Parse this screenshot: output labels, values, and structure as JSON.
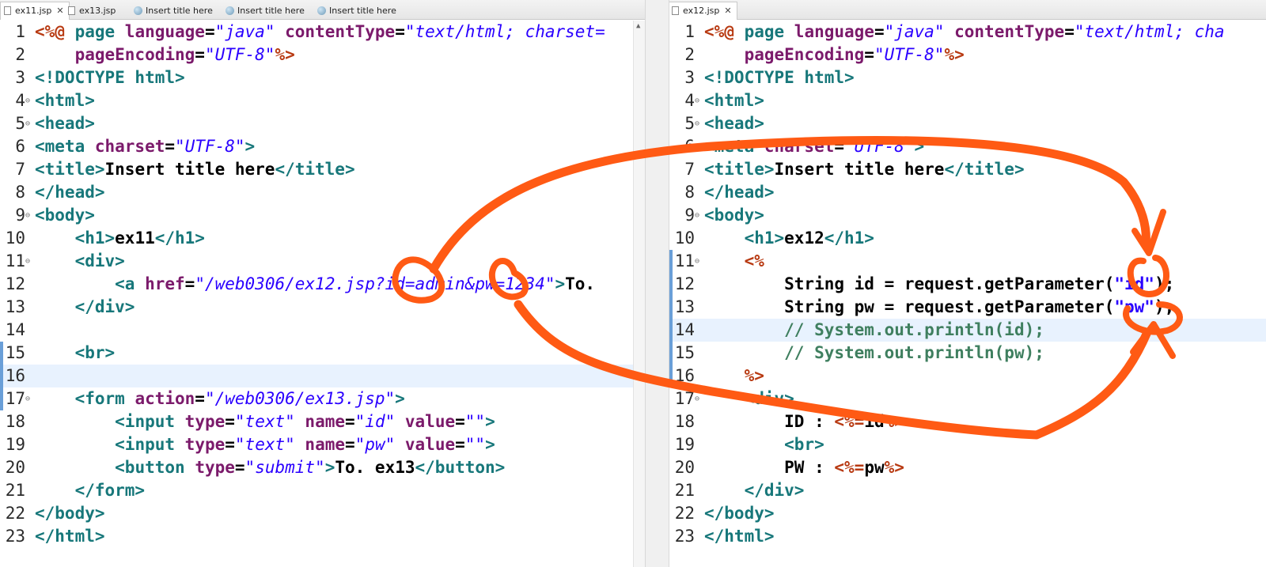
{
  "left_editor": {
    "tabs": [
      {
        "label": "ex11.jsp",
        "icon": "jsp-file-icon",
        "active": true,
        "closable": true
      },
      {
        "label": "ex13.jsp",
        "icon": "jsp-file-icon",
        "active": false,
        "closable": false
      },
      {
        "label": "Insert title here",
        "icon": "globe-icon",
        "active": false,
        "closable": false
      },
      {
        "label": "Insert title here",
        "icon": "globe-icon",
        "active": false,
        "closable": false
      },
      {
        "label": "Insert title here",
        "icon": "globe-icon",
        "active": false,
        "closable": false
      }
    ],
    "highlighted_line": 16,
    "folded_lines": [
      4,
      5,
      9,
      11,
      17
    ],
    "changed_lines": [
      15,
      16,
      17
    ],
    "lines": [
      [
        [
          "jsp",
          "<%@ "
        ],
        [
          "tag",
          "page "
        ],
        [
          "attr",
          "language"
        ],
        [
          "txt",
          "="
        ],
        [
          "val",
          "\"java\""
        ],
        [
          "txt",
          " "
        ],
        [
          "attr",
          "contentType"
        ],
        [
          "txt",
          "="
        ],
        [
          "val",
          "\"text/html; charset="
        ]
      ],
      [
        [
          "txt",
          "    "
        ],
        [
          "attr",
          "pageEncoding"
        ],
        [
          "txt",
          "="
        ],
        [
          "val",
          "\"UTF-8\""
        ],
        [
          "jsp",
          "%>"
        ]
      ],
      [
        [
          "tag",
          "<!DOCTYPE html>"
        ]
      ],
      [
        [
          "tag",
          "<html>"
        ]
      ],
      [
        [
          "tag",
          "<head>"
        ]
      ],
      [
        [
          "tag",
          "<meta "
        ],
        [
          "attr",
          "charset"
        ],
        [
          "txt",
          "="
        ],
        [
          "val",
          "\"UTF-8\""
        ],
        [
          "tag",
          ">"
        ]
      ],
      [
        [
          "tag",
          "<title>"
        ],
        [
          "txt",
          "Insert title here"
        ],
        [
          "tag",
          "</title>"
        ]
      ],
      [
        [
          "tag",
          "</head>"
        ]
      ],
      [
        [
          "tag",
          "<body>"
        ]
      ],
      [
        [
          "txt",
          "    "
        ],
        [
          "tag",
          "<h1>"
        ],
        [
          "txt",
          "ex11"
        ],
        [
          "tag",
          "</h1>"
        ]
      ],
      [
        [
          "txt",
          "    "
        ],
        [
          "tag",
          "<div>"
        ]
      ],
      [
        [
          "txt",
          "        "
        ],
        [
          "tag",
          "<a "
        ],
        [
          "attr",
          "href"
        ],
        [
          "txt",
          "="
        ],
        [
          "val",
          "\"/web0306/ex12.jsp?id=admin&pw=1234\""
        ],
        [
          "tag",
          ">"
        ],
        [
          "txt",
          "To."
        ]
      ],
      [
        [
          "txt",
          "    "
        ],
        [
          "tag",
          "</div>"
        ]
      ],
      [],
      [
        [
          "txt",
          "    "
        ],
        [
          "tag",
          "<br>"
        ]
      ],
      [],
      [
        [
          "txt",
          "    "
        ],
        [
          "tag",
          "<form "
        ],
        [
          "attr",
          "action"
        ],
        [
          "txt",
          "="
        ],
        [
          "val",
          "\"/web0306/ex13.jsp\""
        ],
        [
          "tag",
          ">"
        ]
      ],
      [
        [
          "txt",
          "        "
        ],
        [
          "tag",
          "<input "
        ],
        [
          "attr",
          "type"
        ],
        [
          "txt",
          "="
        ],
        [
          "val",
          "\"text\""
        ],
        [
          "txt",
          " "
        ],
        [
          "attr",
          "name"
        ],
        [
          "txt",
          "="
        ],
        [
          "val",
          "\"id\""
        ],
        [
          "txt",
          " "
        ],
        [
          "attr",
          "value"
        ],
        [
          "txt",
          "="
        ],
        [
          "val",
          "\"\""
        ],
        [
          "tag",
          ">"
        ]
      ],
      [
        [
          "txt",
          "        "
        ],
        [
          "tag",
          "<input "
        ],
        [
          "attr",
          "type"
        ],
        [
          "txt",
          "="
        ],
        [
          "val",
          "\"text\""
        ],
        [
          "txt",
          " "
        ],
        [
          "attr",
          "name"
        ],
        [
          "txt",
          "="
        ],
        [
          "val",
          "\"pw\""
        ],
        [
          "txt",
          " "
        ],
        [
          "attr",
          "value"
        ],
        [
          "txt",
          "="
        ],
        [
          "val",
          "\"\""
        ],
        [
          "tag",
          ">"
        ]
      ],
      [
        [
          "txt",
          "        "
        ],
        [
          "tag",
          "<button "
        ],
        [
          "attr",
          "type"
        ],
        [
          "txt",
          "="
        ],
        [
          "val",
          "\"submit\""
        ],
        [
          "tag",
          ">"
        ],
        [
          "txt",
          "To. ex13"
        ],
        [
          "tag",
          "</button>"
        ]
      ],
      [
        [
          "txt",
          "    "
        ],
        [
          "tag",
          "</form>"
        ]
      ],
      [
        [
          "tag",
          "</body>"
        ]
      ],
      [
        [
          "tag",
          "</html>"
        ]
      ]
    ]
  },
  "right_editor": {
    "tabs": [
      {
        "label": "ex12.jsp",
        "icon": "jsp-file-icon",
        "active": true,
        "closable": true
      }
    ],
    "highlighted_line": 14,
    "folded_lines": [
      4,
      5,
      9,
      11,
      17
    ],
    "changed_lines": [
      11,
      12,
      13,
      14,
      15,
      16
    ],
    "lines": [
      [
        [
          "jsp",
          "<%@ "
        ],
        [
          "tag",
          "page "
        ],
        [
          "attr",
          "language"
        ],
        [
          "txt",
          "="
        ],
        [
          "val",
          "\"java\""
        ],
        [
          "txt",
          " "
        ],
        [
          "attr",
          "contentType"
        ],
        [
          "txt",
          "="
        ],
        [
          "val",
          "\"text/html; cha"
        ]
      ],
      [
        [
          "txt",
          "    "
        ],
        [
          "attr",
          "pageEncoding"
        ],
        [
          "txt",
          "="
        ],
        [
          "val",
          "\"UTF-8\""
        ],
        [
          "jsp",
          "%>"
        ]
      ],
      [
        [
          "tag",
          "<!DOCTYPE html>"
        ]
      ],
      [
        [
          "tag",
          "<html>"
        ]
      ],
      [
        [
          "tag",
          "<head>"
        ]
      ],
      [
        [
          "tag",
          "<meta "
        ],
        [
          "attr",
          "charset"
        ],
        [
          "txt",
          "="
        ],
        [
          "val",
          "\"UTF-8\""
        ],
        [
          "tag",
          ">"
        ]
      ],
      [
        [
          "tag",
          "<title>"
        ],
        [
          "txt",
          "Insert title here"
        ],
        [
          "tag",
          "</title>"
        ]
      ],
      [
        [
          "tag",
          "</head>"
        ]
      ],
      [
        [
          "tag",
          "<body>"
        ]
      ],
      [
        [
          "txt",
          "    "
        ],
        [
          "tag",
          "<h1>"
        ],
        [
          "txt",
          "ex12"
        ],
        [
          "tag",
          "</h1>"
        ]
      ],
      [
        [
          "txt",
          "    "
        ],
        [
          "jsp",
          "<%"
        ]
      ],
      [
        [
          "txt",
          "        String id = request.getParameter("
        ],
        [
          "str",
          "\"id\""
        ],
        [
          "txt",
          ");"
        ]
      ],
      [
        [
          "txt",
          "        String pw = request.getParameter("
        ],
        [
          "str",
          "\"pw\""
        ],
        [
          "txt",
          ");"
        ]
      ],
      [
        [
          "txt",
          "        "
        ],
        [
          "cmt",
          "// System.out.println(id);"
        ]
      ],
      [
        [
          "txt",
          "        "
        ],
        [
          "cmt",
          "// System.out.println(pw);"
        ]
      ],
      [
        [
          "txt",
          "    "
        ],
        [
          "jsp",
          "%>"
        ]
      ],
      [
        [
          "txt",
          "    "
        ],
        [
          "tag",
          "<div>"
        ]
      ],
      [
        [
          "txt",
          "        ID : "
        ],
        [
          "jsp",
          "<%="
        ],
        [
          "txt",
          "id"
        ],
        [
          "jsp",
          "%>"
        ]
      ],
      [
        [
          "txt",
          "        "
        ],
        [
          "tag",
          "<br>"
        ]
      ],
      [
        [
          "txt",
          "        PW : "
        ],
        [
          "jsp",
          "<%="
        ],
        [
          "txt",
          "pw"
        ],
        [
          "jsp",
          "%>"
        ]
      ],
      [
        [
          "txt",
          "    "
        ],
        [
          "tag",
          "</div>"
        ]
      ],
      [
        [
          "tag",
          "</body>"
        ]
      ],
      [
        [
          "tag",
          "</html>"
        ]
      ]
    ]
  },
  "annotation": {
    "color": "#ff5a14"
  },
  "colors": {
    "tag": "#17777a",
    "jsp": "#b83a12",
    "attr": "#7b1a6b",
    "value": "#2a00ff",
    "comment": "#3f7f5f",
    "highlight": "#e8f2fe"
  }
}
